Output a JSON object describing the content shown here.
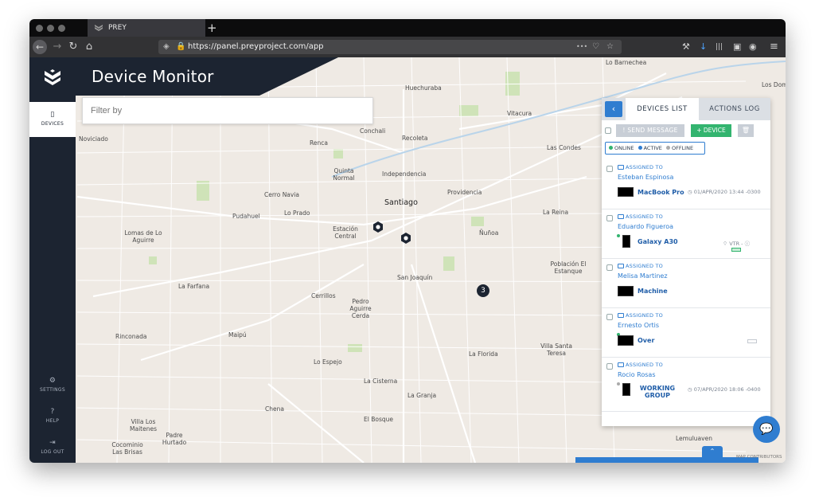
{
  "browser": {
    "tab_title": "PREY",
    "new_tab": "+",
    "url": "https://panel.preyproject.com/app",
    "nav": {
      "back": "←",
      "forward": "→",
      "reload": "↻",
      "home": "⌂"
    },
    "icons": {
      "menu_dots": "•••",
      "pocket": "♡",
      "bookmark": "☆",
      "wrench": "🔧",
      "download": "↓",
      "library": "|||",
      "sidebar": "▣",
      "account": "◉",
      "hamburger": "≡"
    }
  },
  "app": {
    "title": "Device Monitor",
    "filter_placeholder": "Filter by",
    "sidebar": {
      "devices": "DEVICES",
      "settings": "SETTINGS",
      "help": "HELP",
      "logout": "LOG OUT"
    },
    "map": {
      "labels": [
        "Huechuraba",
        "Lo Barnechea",
        "Conchali",
        "Recoleta",
        "Vitacura",
        "Renca",
        "Las Condes",
        "Quinta Normal",
        "Independencia",
        "Providencia",
        "Cerro Navia",
        "Santiago",
        "La Reina",
        "Pudahuel",
        "Lo Prado",
        "Estación Central",
        "Ñuñoa",
        "Lomas de Lo Aguirre",
        "Población El Estanque",
        "La Farfana",
        "Cerrillos",
        "Pedro Aguirre Cerda",
        "San Joaquín",
        "Rinconada",
        "Maipú",
        "Villa Santa Teresa",
        "Lo Espejo",
        "La Florida",
        "Chena",
        "La Cisterna",
        "La Granja",
        "El Bosque",
        "Villa Los Maitenes",
        "Padre Hurtado",
        "Cocominio Las Brisas",
        "Lemuluaven",
        "Noviciado",
        "Los Dominicos"
      ],
      "cluster_count": "3",
      "attribution": "MAP CONTRIBUTORS"
    },
    "panel": {
      "tab_devices": "DEVICES LIST",
      "tab_actions": "ACTIONS LOG",
      "collapse": "‹",
      "send_message": "! SEND MESSAGE",
      "add_device": "+ DEVICE",
      "delete": "🗑",
      "legend": {
        "online": "ONLINE",
        "active": "ACTIVE",
        "offline": "OFFLINE"
      },
      "legend_colors": {
        "online": "#33b46f",
        "active": "#2f7dd0",
        "offline": "#aaaaaa"
      },
      "assigned_label": "ASSIGNED TO",
      "devices": [
        {
          "user": "Esteban Espinosa",
          "device": "MacBook Pro",
          "meta": "01/APR/2020 13:44 -0300"
        },
        {
          "user": "Eduardo Figueroa",
          "device": "Galaxy A30",
          "meta": "VTR -"
        },
        {
          "user": "Melisa Martinez",
          "device": "Machine",
          "meta": ""
        },
        {
          "user": "Ernesto Ortis",
          "device": "Over",
          "meta": ""
        },
        {
          "user": "Rocio Rosas",
          "device": "WORKING GROUP",
          "meta": "07/APR/2020 18:06 -0400"
        }
      ]
    },
    "chat_icon": "💬",
    "up_icon": "⌃"
  }
}
